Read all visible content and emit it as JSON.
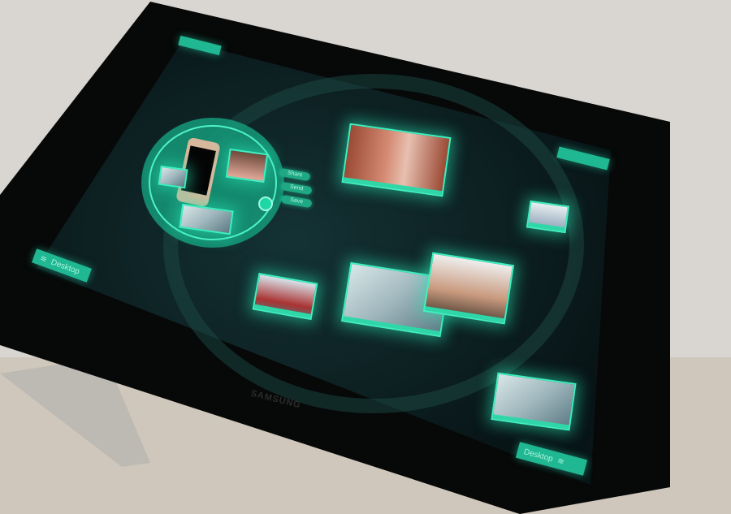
{
  "device": {
    "brand_logo": "SAMSUNG"
  },
  "desktop_tabs": [
    {
      "label": "Desktop"
    },
    {
      "label": "Desktop"
    }
  ],
  "hub": {
    "actions": [
      {
        "label": "Share"
      },
      {
        "label": "Send"
      },
      {
        "label": "Save"
      }
    ]
  },
  "colors": {
    "accent": "#2fd7a8",
    "screen": "#0c1a1c",
    "bezel": "#0a0a0a"
  }
}
